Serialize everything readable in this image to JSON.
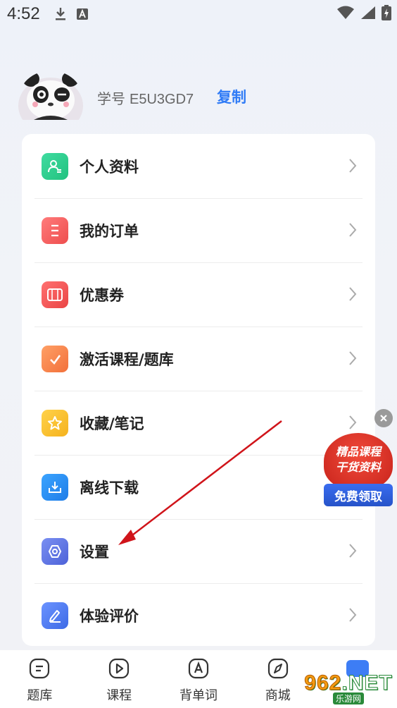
{
  "status_bar": {
    "time": "4:52"
  },
  "profile": {
    "student_id_label": "学号",
    "student_id": "E5U3GD7",
    "copy_label": "复制"
  },
  "menu": {
    "items": [
      {
        "label": "个人资料",
        "icon": "profile-icon",
        "color": "#2fcf8e"
      },
      {
        "label": "我的订单",
        "icon": "order-icon",
        "color": "#f25a5a"
      },
      {
        "label": "优惠券",
        "icon": "coupon-icon",
        "color": "#f05050"
      },
      {
        "label": "激活课程/题库",
        "icon": "activate-icon",
        "color": "#f5834a"
      },
      {
        "label": "收藏/笔记",
        "icon": "star-icon",
        "color": "#f8c02b"
      },
      {
        "label": "离线下载",
        "icon": "download-icon",
        "color": "#2e8bf0"
      },
      {
        "label": "设置",
        "icon": "settings-icon",
        "color": "#5b74e6"
      },
      {
        "label": "体验评价",
        "icon": "edit-icon",
        "color": "#4c7bf0"
      }
    ]
  },
  "promo": {
    "line1": "精品课程",
    "line2": "干货资料",
    "button": "免费领取"
  },
  "tab_bar": {
    "tabs": [
      {
        "label": "题库",
        "icon": "question-bank-icon"
      },
      {
        "label": "课程",
        "icon": "course-play-icon"
      },
      {
        "label": "背单词",
        "icon": "vocabulary-icon"
      },
      {
        "label": "商城",
        "icon": "mall-compass-icon"
      },
      {
        "label": "",
        "icon": "me-icon",
        "active": true
      }
    ]
  },
  "watermark": {
    "brand_a": "962",
    "brand_b": ".NET",
    "sub": "乐游网"
  }
}
